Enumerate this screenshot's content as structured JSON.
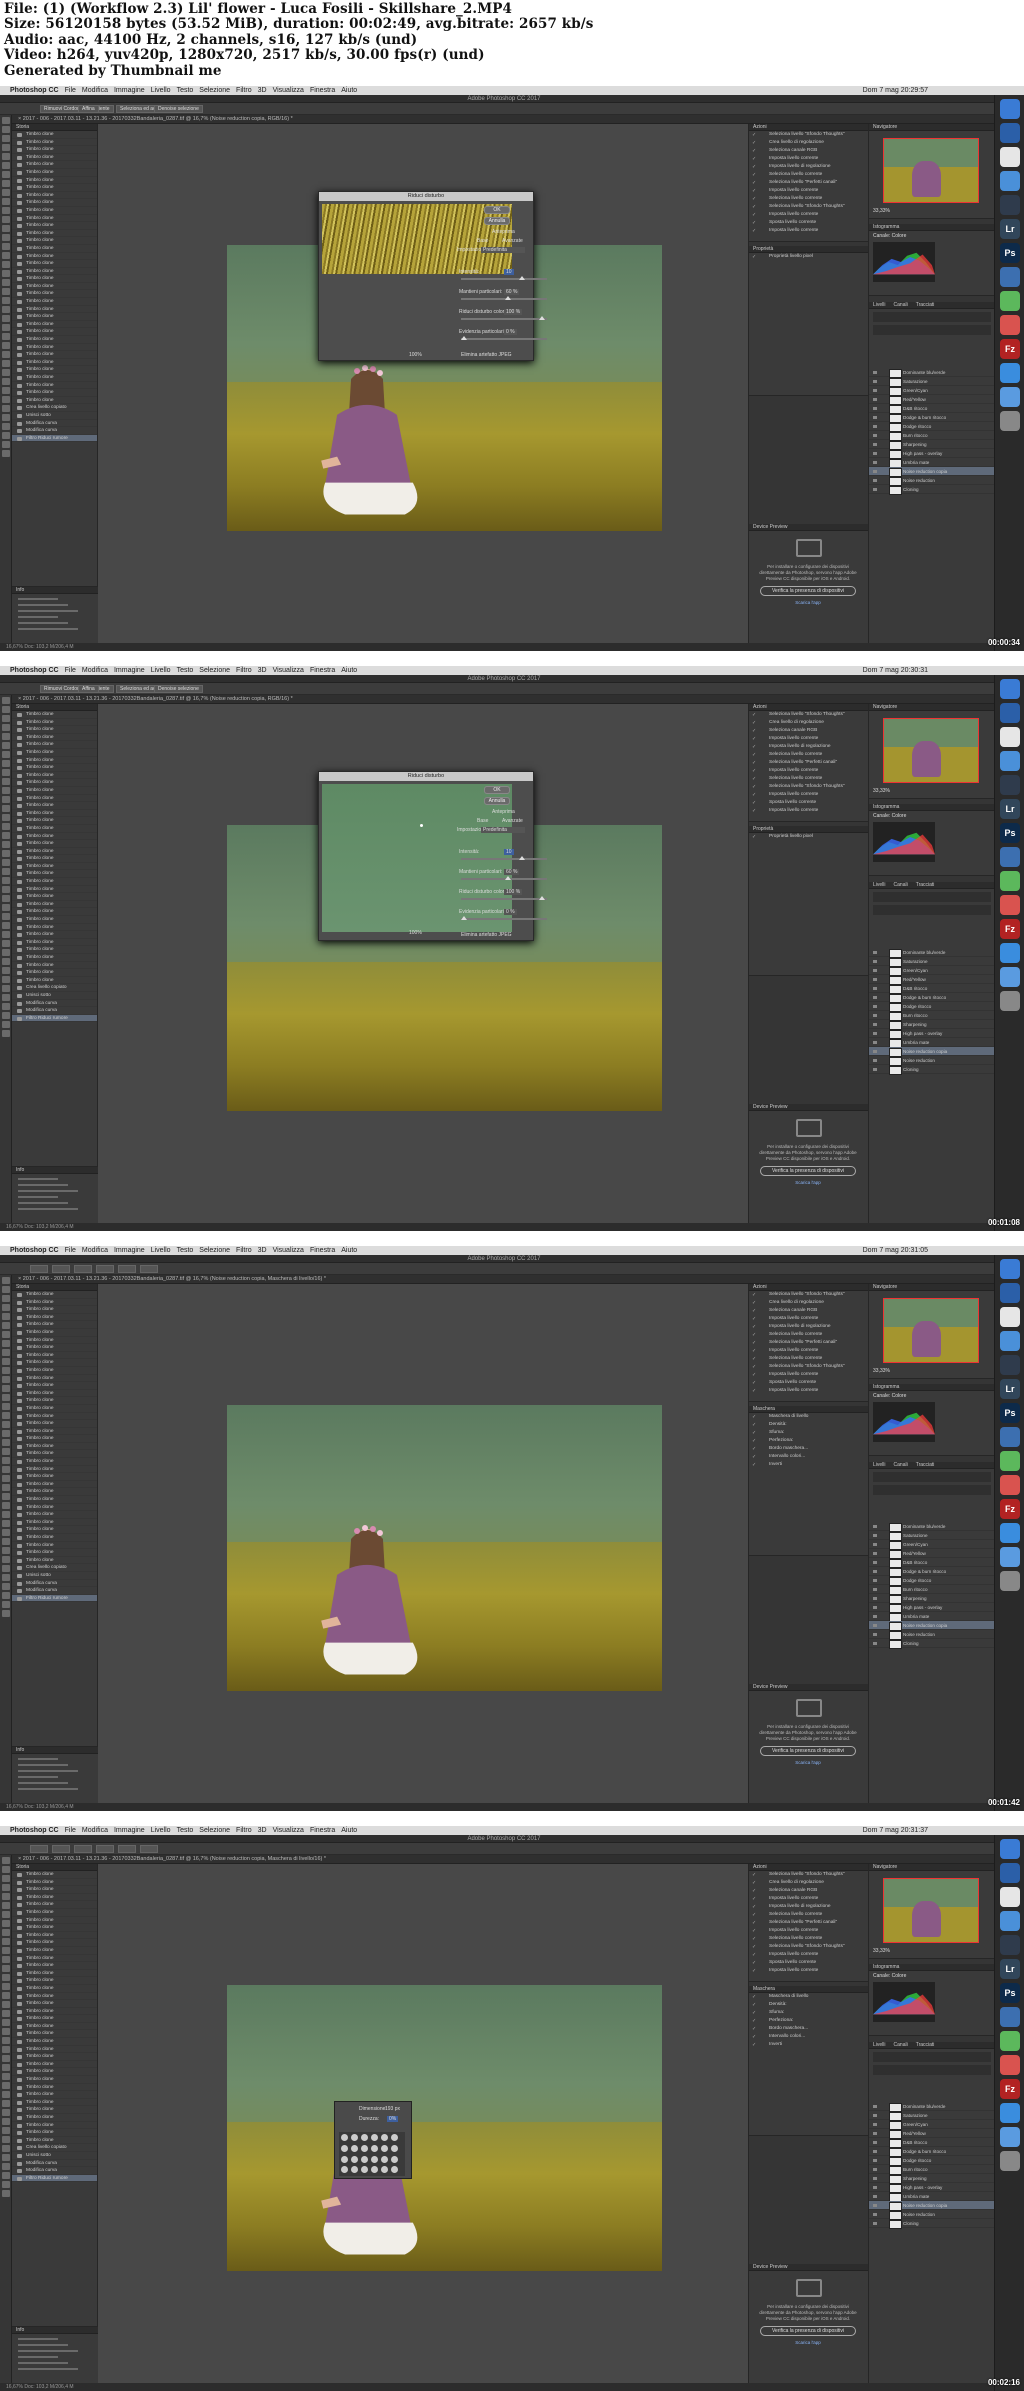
{
  "header": {
    "lines": [
      "File: (1) (Workflow 2.3) Lil' flower - Luca Fosili - Skillshare_2.MP4",
      "Size: 56120158 bytes (53.52 MiB), duration: 00:02:49, avg.bitrate: 2657 kb/s",
      "Audio: aac, 44100 Hz, 2 channels, s16, 127 kb/s (und)",
      "Video: h264, yuv420p, 1280x720, 2517 kb/s, 30.00 fps(r) (und)",
      "Generated by Thumbnail me"
    ]
  },
  "menu": {
    "apple": "",
    "app": "Photoshop CC",
    "items": [
      "File",
      "Modifica",
      "Immagine",
      "Livello",
      "Testo",
      "Selezione",
      "Filtro",
      "3D",
      "Visualizza",
      "Finestra",
      "Aiuto"
    ]
  },
  "app_title": "Adobe Photoshop CC 2017",
  "options_bar": [
    "Rimuovi Cordoni di Gradiente",
    "Affina",
    "Seleziona ed adiacente",
    "Denoise selezione"
  ],
  "history_panel": {
    "title": "Storia",
    "items": [
      "Timbro clone",
      "Timbro clone",
      "Timbro clone",
      "Timbro clone",
      "Timbro clone",
      "Timbro clone",
      "Timbro clone",
      "Timbro clone",
      "Timbro clone",
      "Timbro clone",
      "Timbro clone",
      "Timbro clone",
      "Timbro clone",
      "Timbro clone",
      "Timbro clone",
      "Timbro clone",
      "Timbro clone",
      "Timbro clone",
      "Timbro clone",
      "Timbro clone",
      "Timbro clone",
      "Timbro clone",
      "Timbro clone",
      "Timbro clone",
      "Timbro clone",
      "Timbro clone",
      "Timbro clone",
      "Timbro clone",
      "Timbro clone",
      "Timbro clone",
      "Timbro clone",
      "Timbro clone",
      "Timbro clone",
      "Timbro clone",
      "Timbro clone",
      "Timbro clone",
      "Crea livello copiato",
      "Unisci sotto",
      "Modifica curva",
      "Modifica curva",
      "Filtro Riduci rumore"
    ]
  },
  "info_panel": {
    "title": "Info"
  },
  "actions_panel": {
    "title": "Azioni",
    "items": [
      "Seleziona livello \"Sfondo Thoughts\"",
      "Crea livello di regolazione",
      "Seleziona canale RGB",
      "Imposta livello corrente",
      "Imposta livello di regolazione",
      "Seleziona livello corrente",
      "Seleziona livello \"Perfetti canali\"",
      "Imposta livello corrente",
      "Seleziona livello corrente",
      "Seleziona livello \"Sfondo Thoughts\"",
      "Imposta livello corrente",
      "Sposta livello corrente",
      "Imposta livello corrente"
    ]
  },
  "properties_panel": {
    "title": "Proprietà",
    "subtitle": "Proprietà livello pixel"
  },
  "device_preview": {
    "title": "Device Preview",
    "text": "Per installare o configurare dei dispositivi direttamente da Photoshop, servono l'app Adobe Preview CC disponibile per iOS e Android.",
    "button": "Verifica la presenza di dispositivi",
    "link": "Scarica l'app"
  },
  "navigator": {
    "title": "Navigatore",
    "zoom": "33,33%"
  },
  "histogram": {
    "title": "Istogramma",
    "channel": "Canale: Colore"
  },
  "layers_panel": {
    "title": "Livelli",
    "tabs": [
      "Livelli",
      "Canali",
      "Tracciati"
    ],
    "items": [
      "Dominante blu/verde",
      "Saturazione",
      "Green/Cyan",
      "Red/Yellow",
      "D&B ritocco",
      "Dodge & burn ritocco",
      "Dodge ritocco",
      "Burn ritocco",
      "Sharpening",
      "High pass - overlay",
      "Umbria mate",
      "Noise reduction copia",
      "Noise reduction",
      "Cloning"
    ]
  },
  "dialog": {
    "title": "Riduci disturbo",
    "ok": "OK",
    "cancel": "Annulla",
    "preview": "Anteprima",
    "basic": "Base",
    "advanced": "Avanzate",
    "preset_label": "Impostazione:",
    "preset": "Predefinita",
    "intensity": "Intensità:",
    "intensity_val": "10",
    "preserve": "Mantieni particolari:",
    "preserve_val": "60 %",
    "color_noise": "Riduci disturbo colore:",
    "color_noise_val": "100 %",
    "sharpen": "Evidenzia particolari:",
    "sharpen_val": "0 %",
    "jpeg": "Elimina artefatto JPEG",
    "zoom": "100%"
  },
  "masks_panel": {
    "title": "Maschera",
    "subtitle": "Maschera di livello",
    "density": "Densità:",
    "feather": "Sfuma:",
    "refine": "Perfeziona:",
    "edge": "Bordo maschera...",
    "range": "Intervallo colori...",
    "invert": "Inverti"
  },
  "brush_popup": {
    "size_label": "Dimensione:",
    "size": "193 px",
    "hardness_label": "Durezza:",
    "hardness": "0%"
  },
  "frames": [
    {
      "clock": "Dom 7 mag  20:29:57",
      "doc_tab": "× 2017 - 006 - 2017.03.11 - 13.21.36 - 20170332Bandaleria_0287.tif @ 16,7% (Noise reduction copia, RGB/16) *",
      "timestamp": "00:00:34"
    },
    {
      "clock": "Dom 7 mag  20:30:31",
      "doc_tab": "× 2017 - 006 - 2017.03.11 - 13.21.36 - 20170332Bandaleria_0287.tif @ 16,7% (Noise reduction copia, RGB/16) *",
      "timestamp": "00:01:08"
    },
    {
      "clock": "Dom 7 mag  20:31:05",
      "doc_tab": "× 2017 - 006 - 2017.03.11 - 13.21.36 - 20170332Bandaleria_0287.tif @ 16,7% (Noise reduction copia, Maschera di livello/16) *",
      "timestamp": "00:01:42"
    },
    {
      "clock": "Dom 7 mag  20:31:37",
      "doc_tab": "× 2017 - 006 - 2017.03.11 - 13.21.36 - 20170332Bandaleria_0287.tif @ 16,7% (Noise reduction copia, Maschera di livello/16) *",
      "timestamp": "00:02:16"
    }
  ],
  "status": "16,67%     Doc: 103,2 M/206,4 M",
  "dock_icons": [
    {
      "label": "",
      "color": "#3a7bd5"
    },
    {
      "label": "",
      "color": "#2b5fa8"
    },
    {
      "label": "",
      "color": "#e6e6e6"
    },
    {
      "label": "",
      "color": "#4a90d9"
    },
    {
      "label": "",
      "color": "#2f3b4c"
    },
    {
      "label": "Lr",
      "color": "#31465a"
    },
    {
      "label": "Ps",
      "color": "#0d2a4a"
    },
    {
      "label": "",
      "color": "#3c6fb0"
    },
    {
      "label": "",
      "color": "#5cb85c"
    },
    {
      "label": "",
      "color": "#d9534f"
    },
    {
      "label": "Fz",
      "color": "#b22222"
    },
    {
      "label": "",
      "color": "#3a8dde"
    },
    {
      "label": "",
      "color": "#5a9be0"
    },
    {
      "label": "",
      "color": "#888888"
    }
  ]
}
